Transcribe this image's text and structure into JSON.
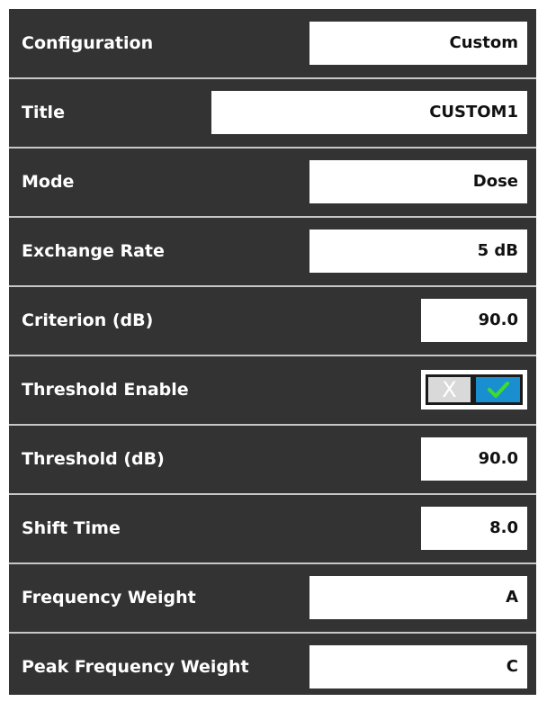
{
  "settings": {
    "configuration": {
      "label": "Configuration",
      "value": "Custom"
    },
    "title": {
      "label": "Title",
      "value": "CUSTOM1"
    },
    "mode": {
      "label": "Mode",
      "value": "Dose"
    },
    "exchange_rate": {
      "label": "Exchange Rate",
      "value": "5 dB"
    },
    "criterion": {
      "label": "Criterion (dB)",
      "value": "90.0"
    },
    "threshold_enable": {
      "label": "Threshold Enable",
      "off_glyph": "X",
      "enabled": true,
      "icon_on": "checkmark-icon",
      "icon_off": "x-icon"
    },
    "threshold": {
      "label": "Threshold (dB)",
      "value": "90.0"
    },
    "shift_time": {
      "label": "Shift Time",
      "value": "8.0"
    },
    "frequency_weight": {
      "label": "Frequency Weight",
      "value": "A"
    },
    "peak_frequency_weight": {
      "label": "Peak Frequency Weight",
      "value": "C"
    }
  },
  "colors": {
    "background": "#333333",
    "divider": "#c8c8c8",
    "toggle_on": "#1a8fd0",
    "check": "#3ddc2f"
  }
}
